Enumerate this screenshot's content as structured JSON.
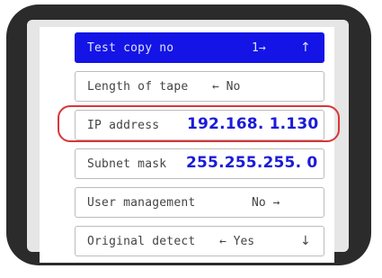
{
  "menu": {
    "items": [
      {
        "label": "Test copy no",
        "value": "1→",
        "nav": "↑",
        "selected": true
      },
      {
        "label": "Length of tape",
        "value": "← No"
      },
      {
        "label": "IP address",
        "value": "192.168. 1.130",
        "highlighted": true
      },
      {
        "label": "Subnet mask",
        "value": "255.255.255. 0"
      },
      {
        "label": "User management",
        "value": "No →"
      },
      {
        "label": "Original detect",
        "value": "← Yes",
        "nav": "↓"
      }
    ]
  },
  "colors": {
    "selected_bg": "#1414e6",
    "value_blue": "#1b1bd8",
    "highlight_ring": "#d9363a",
    "bezel": "#2b2b2b"
  }
}
